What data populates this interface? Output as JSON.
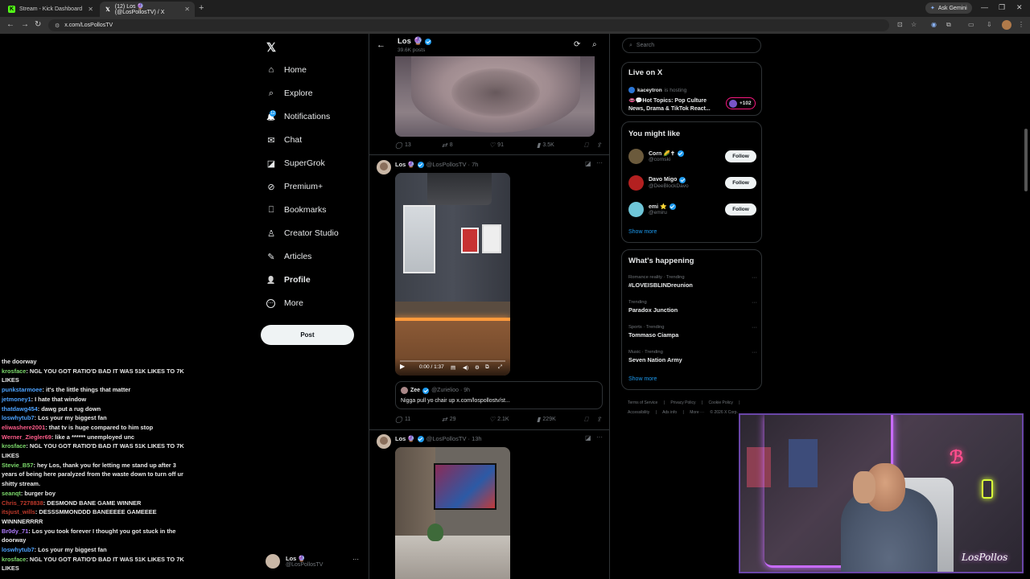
{
  "browser": {
    "tabs": [
      {
        "title": "Stream - Kick Dashboard",
        "icon": "kick-icon",
        "color": "#53fc18"
      },
      {
        "title": "(12) Los 🔮 (@LosPollosTV) / X",
        "icon": "x-icon",
        "color": "#ffffff"
      }
    ],
    "new_tab": "+",
    "gemini": "Ask Gemini",
    "url": "x.com/LosPollosTV"
  },
  "nav": {
    "logo": "𝕏",
    "items": [
      {
        "label": "Home",
        "icon": "home-icon",
        "glyph": "⌂"
      },
      {
        "label": "Explore",
        "icon": "search-icon",
        "glyph": "⌕"
      },
      {
        "label": "Notifications",
        "icon": "bell-icon",
        "glyph": "🔔"
      },
      {
        "label": "Chat",
        "icon": "mail-icon",
        "glyph": "✉"
      },
      {
        "label": "SuperGrok",
        "icon": "grok-icon",
        "glyph": "◪"
      },
      {
        "label": "Premium+",
        "icon": "premium-icon",
        "glyph": "⊘"
      },
      {
        "label": "Bookmarks",
        "icon": "bookmark-icon",
        "glyph": "⎕"
      },
      {
        "label": "Creator Studio",
        "icon": "creator-studio-icon",
        "glyph": "♙"
      },
      {
        "label": "Articles",
        "icon": "articles-icon",
        "glyph": "✎"
      },
      {
        "label": "Profile",
        "icon": "profile-icon",
        "glyph": "👤"
      },
      {
        "label": "More",
        "icon": "more-icon",
        "glyph": "⋯"
      }
    ],
    "notif_count": "12",
    "post_label": "Post",
    "account": {
      "name": "Los 🔮",
      "handle": "@LosPollosTV",
      "more": "···"
    }
  },
  "header": {
    "name": "Los 🔮",
    "sub": "39.6K posts"
  },
  "tweets": [
    {
      "replies": "13",
      "reposts": "8",
      "likes": "91",
      "views": "3.5K"
    },
    {
      "name": "Los 🔮",
      "handle": "@LosPollosTV",
      "time": "· 7h",
      "video_time": "0:00 / 1:37",
      "quote": {
        "name": "Zee",
        "handle": "@Zurielioo",
        "time": "· 9h",
        "text": "Nigga pull yo chair up x.com/lospollostv/st..."
      },
      "replies": "11",
      "reposts": "29",
      "likes": "2.1K",
      "views": "229K"
    },
    {
      "name": "Los 🔮",
      "handle": "@LosPollosTV",
      "time": "· 13h"
    }
  ],
  "chat": [
    {
      "user": "",
      "text": "the doorway",
      "color": "#eaeaea"
    },
    {
      "user": "krosface",
      "text": "NGL YOU GOT RATIO'D BAD IT WAS 51K LIKES TO 7K LIKES",
      "color": "#7cd96b"
    },
    {
      "user": "punkstarmoee",
      "text": "it's the little things that matter",
      "color": "#4da3ff"
    },
    {
      "user": "jetmoney1",
      "text": "I hate that window",
      "color": "#4da3ff"
    },
    {
      "user": "thatdawg454",
      "text": "dawg put a rug down",
      "color": "#4da3ff"
    },
    {
      "user": "loswhytub7",
      "text": "Los your my biggest fan",
      "color": "#4da3ff"
    },
    {
      "user": "eliwashere2001",
      "text": "that tv is huge compared to him stop",
      "color": "#ff5c8a"
    },
    {
      "user": "Werner_Ziegler69",
      "text": "like a ****** unemployed unc",
      "color": "#ff5c8a"
    },
    {
      "user": "krosface",
      "text": "NGL YOU GOT RATIO'D BAD IT WAS 51K LIKES TO 7K LIKES",
      "color": "#7cd96b"
    },
    {
      "user": "Stevie_B57",
      "text": "hey Los, thank you for letting me stand up after 3 years of being here paralyzed from the waste down to turn off ur shitty stream.",
      "color": "#7cd96b"
    },
    {
      "user": "seanqt",
      "text": "burger boy",
      "color": "#7cd96b"
    },
    {
      "user": "Chris_7278838",
      "text": "DESMOND BANE GAME WINNER",
      "color": "#c0392b"
    },
    {
      "user": "itsjust_wills",
      "text": "DESSSMMONDDD BANEEEEE GAMEEEE WINNNERRRR",
      "color": "#c0392b"
    },
    {
      "user": "Br0dy_71",
      "text": "Los you took forever I thought you got stuck in the doorway",
      "color": "#b07cff"
    },
    {
      "user": "loswhytub7",
      "text": "Los your my biggest fan",
      "color": "#4da3ff"
    },
    {
      "user": "krosface",
      "text": "NGL YOU GOT RATIO'D BAD IT WAS 51K LIKES TO 7K LIKES",
      "color": "#7cd96b"
    }
  ],
  "right": {
    "search_placeholder": "Search",
    "live": {
      "title": "Live on X",
      "host": "kaceytron",
      "host_suffix": "is hosting",
      "topic": "👄💬Hot Topics: Pop Culture News, Drama & TikTok React...",
      "count": "+102"
    },
    "wtf": {
      "title": "You might like",
      "users": [
        {
          "name": "Corn 🌽✝",
          "handle": "@cornski",
          "color": "#6b5a3c",
          "follow": "Follow"
        },
        {
          "name": "Davo Migo",
          "handle": "@DeeBlockDavo",
          "color": "#b32020",
          "follow": "Follow"
        },
        {
          "name": "emi ⭐",
          "handle": "@emiru",
          "color": "#6fc6d8",
          "follow": "Follow"
        }
      ],
      "show_more": "Show more"
    },
    "happening": {
      "title": "What's happening",
      "trends": [
        {
          "cat": "Romance reality · Trending",
          "name": "#LOVEISBLINDreunion"
        },
        {
          "cat": "Trending",
          "name": "Paradox Junction"
        },
        {
          "cat": "Sports · Trending",
          "name": "Tommaso Ciampa"
        },
        {
          "cat": "Music · Trending",
          "name": "Seven Nation Army"
        }
      ],
      "show_more": "Show more"
    },
    "footer": [
      "Terms of Service",
      "|",
      "Privacy Policy",
      "|",
      "Cookie Policy",
      "|",
      "Accessibility",
      "|",
      "Ads info",
      "|",
      "More ···",
      "© 2026 X Corp."
    ]
  },
  "cam": {
    "signature": "LosPollos"
  }
}
